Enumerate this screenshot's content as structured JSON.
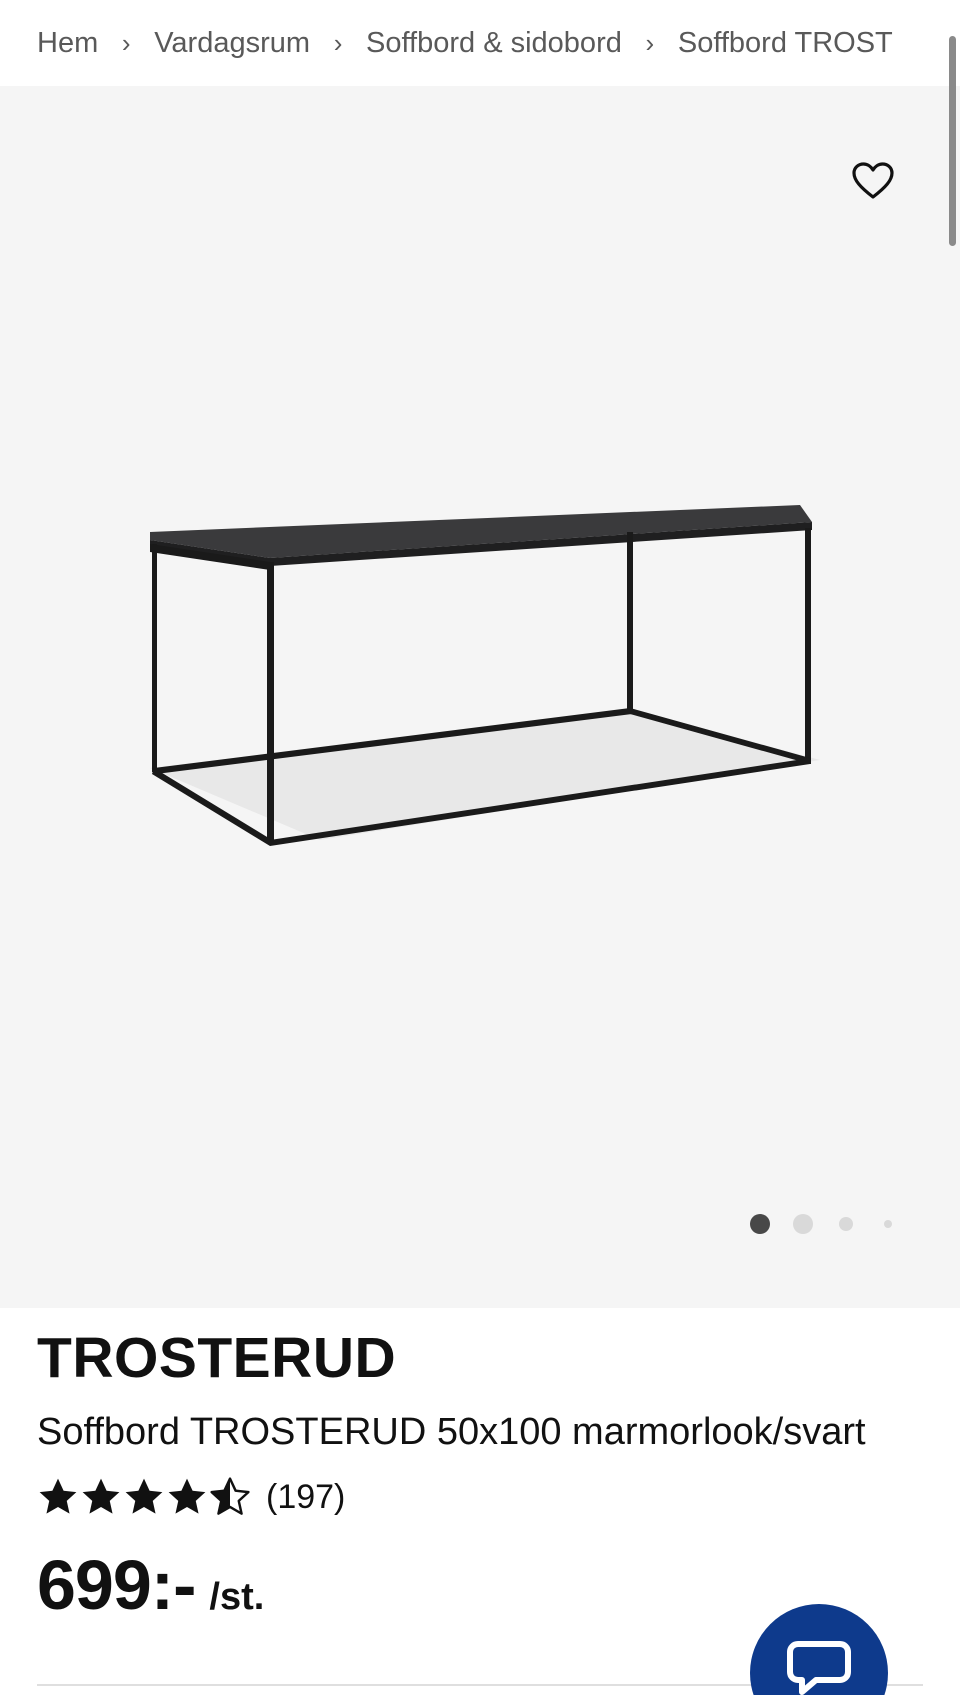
{
  "breadcrumb": {
    "items": [
      "Hem",
      "Vardagsrum",
      "Soffbord & sidobord",
      "Soffbord TROST"
    ],
    "separator": "›"
  },
  "gallery": {
    "favorite_icon": "heart-outline-icon",
    "image_alt": "Soffbord TROSTERUD",
    "slide_count": 4,
    "active_slide": 1
  },
  "product": {
    "brand": "TROSTERUD",
    "description": "Soffbord TROSTERUD 50x100 marmorlook/svart",
    "rating": {
      "value": 4.5,
      "max": 5,
      "count_text": "(197)"
    },
    "price": {
      "amount": "699:-",
      "unit": "/st."
    }
  },
  "chat": {
    "icon": "chat-bubble-icon",
    "color": "#0e3a8c"
  },
  "colors": {
    "gallery_background": "#f5f5f5",
    "text": "#111111",
    "breadcrumb_text": "#595959"
  }
}
